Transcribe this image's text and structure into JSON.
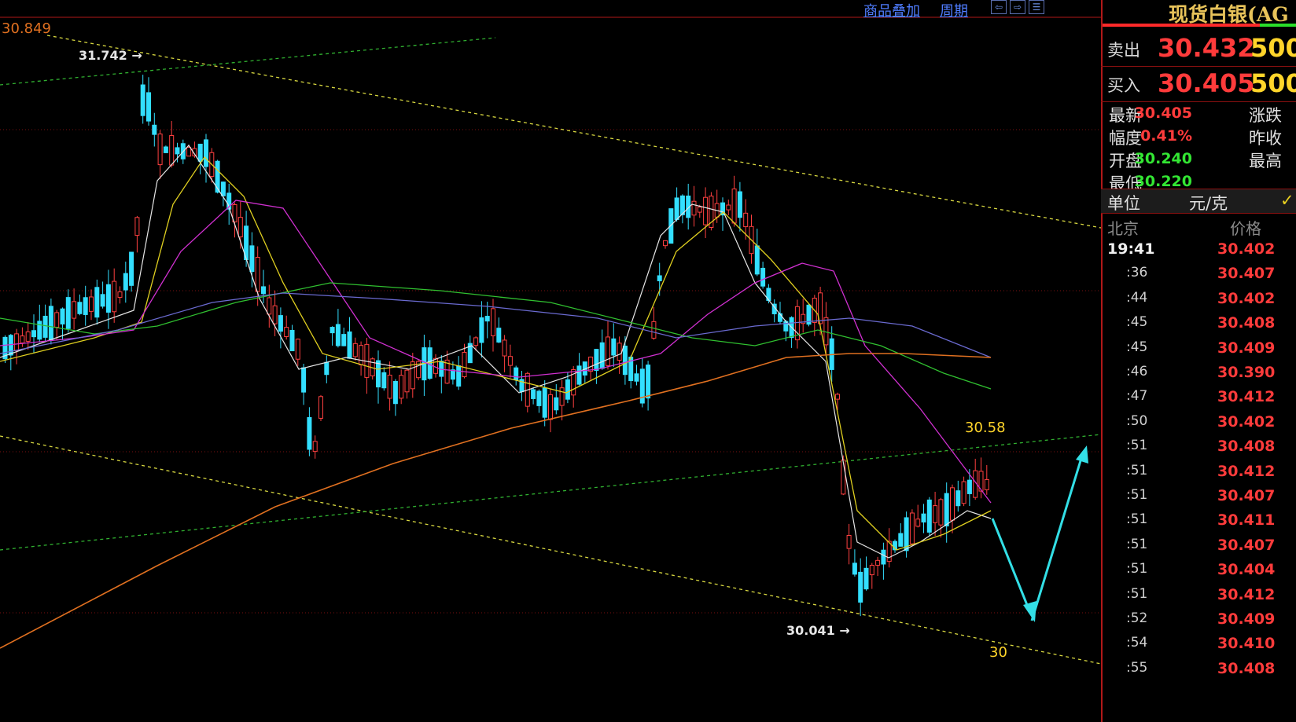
{
  "toolbar": {
    "overlay_label": "商品叠加",
    "period_label": "周期",
    "nav_left": "⇦",
    "nav_right": "⇨",
    "nav_menu": "☰"
  },
  "chart_data": {
    "type": "candlestick",
    "top_price_label": "30.849",
    "annotations": {
      "high_marker": "31.742",
      "low_marker": "30.041",
      "target_high": "30.58",
      "target_low": "30"
    },
    "colors": {
      "up": "#ff4040",
      "down": "#33dfff",
      "ma_white": "#e6e6e6",
      "ma_yellow": "#e0d020",
      "ma_magenta": "#d030d0",
      "ma_green": "#30c030",
      "ma_purple": "#6a6ad0",
      "ma_orange": "#e07020",
      "channel_yellow": "#d8d840",
      "channel_green": "#30b030",
      "arrow": "#33dfe6",
      "gridline": "#7a1010"
    }
  },
  "panel": {
    "title": "现货白银(AG",
    "sell_label": "卖出",
    "sell_price": "30.432",
    "sell_qty": "500",
    "buy_label": "买入",
    "buy_price": "30.405",
    "buy_qty": "500",
    "info": [
      {
        "label": "最新",
        "value": "30.405",
        "color": "#ff3b3b",
        "label2": "涨跌"
      },
      {
        "label": "幅度",
        "value": "0.41%",
        "color": "#ff3b3b",
        "label2": "昨收"
      },
      {
        "label": "开盘",
        "value": "30.240",
        "color": "#33e633",
        "label2": "最高"
      },
      {
        "label": "最低",
        "value": "30.220",
        "color": "#33e633",
        "label2": ""
      }
    ],
    "unit_label": "单位",
    "unit_value": "元/克",
    "unit_check": "✓",
    "ticks_header_city": "北京",
    "ticks_header_price": "价格",
    "ticks": [
      {
        "time": "19:41",
        "price": "30.402"
      },
      {
        "time": ":36",
        "price": "30.407"
      },
      {
        "time": ":44",
        "price": "30.402"
      },
      {
        "time": ":45",
        "price": "30.408"
      },
      {
        "time": ":45",
        "price": "30.409"
      },
      {
        "time": ":46",
        "price": "30.390"
      },
      {
        "time": ":47",
        "price": "30.412"
      },
      {
        "time": ":50",
        "price": "30.402"
      },
      {
        "time": ":51",
        "price": "30.408"
      },
      {
        "time": ":51",
        "price": "30.412"
      },
      {
        "time": ":51",
        "price": "30.407"
      },
      {
        "time": ":51",
        "price": "30.411"
      },
      {
        "time": ":51",
        "price": "30.407"
      },
      {
        "time": ":51",
        "price": "30.404"
      },
      {
        "time": ":51",
        "price": "30.412"
      },
      {
        "time": ":52",
        "price": "30.409"
      },
      {
        "time": ":54",
        "price": "30.410"
      },
      {
        "time": ":55",
        "price": "30.408"
      }
    ]
  }
}
